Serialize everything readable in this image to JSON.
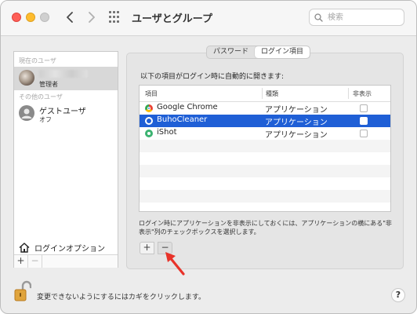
{
  "window": {
    "title": "ユーザとグループ"
  },
  "search": {
    "placeholder": "検索"
  },
  "sidebar": {
    "current_section": "現在のユーザ",
    "current_user": {
      "role": "管理者"
    },
    "other_section": "その他のユーザ",
    "guest": {
      "name": "ゲストユーザ",
      "status": "オフ"
    },
    "login_options": "ログインオプション",
    "add": "+",
    "remove": "−"
  },
  "tabs": [
    {
      "label": "パスワード"
    },
    {
      "label": "ログイン項目"
    }
  ],
  "main": {
    "instruction": "以下の項目がログイン時に自動的に開きます:",
    "columns": {
      "item": "項目",
      "kind": "種類",
      "hide": "非表示"
    },
    "items": [
      {
        "name": "Google Chrome",
        "kind": "アプリケーション"
      },
      {
        "name": "BuhoCleaner",
        "kind": "アプリケーション"
      },
      {
        "name": "iShot",
        "kind": "アプリケーション"
      }
    ],
    "note": "ログイン時にアプリケーションを非表示にしておくには、アプリケーションの横にある\"非表示\"列のチェックボックスを選択します。",
    "add": "+",
    "remove": "−"
  },
  "footer": {
    "lock_text": "変更できないようにするにはカギをクリックします。",
    "help": "?"
  },
  "colors": {
    "selection": "#1f5fd6",
    "arrow": "#e8332a",
    "close": "#fe5f57",
    "minimize": "#febc2e"
  }
}
